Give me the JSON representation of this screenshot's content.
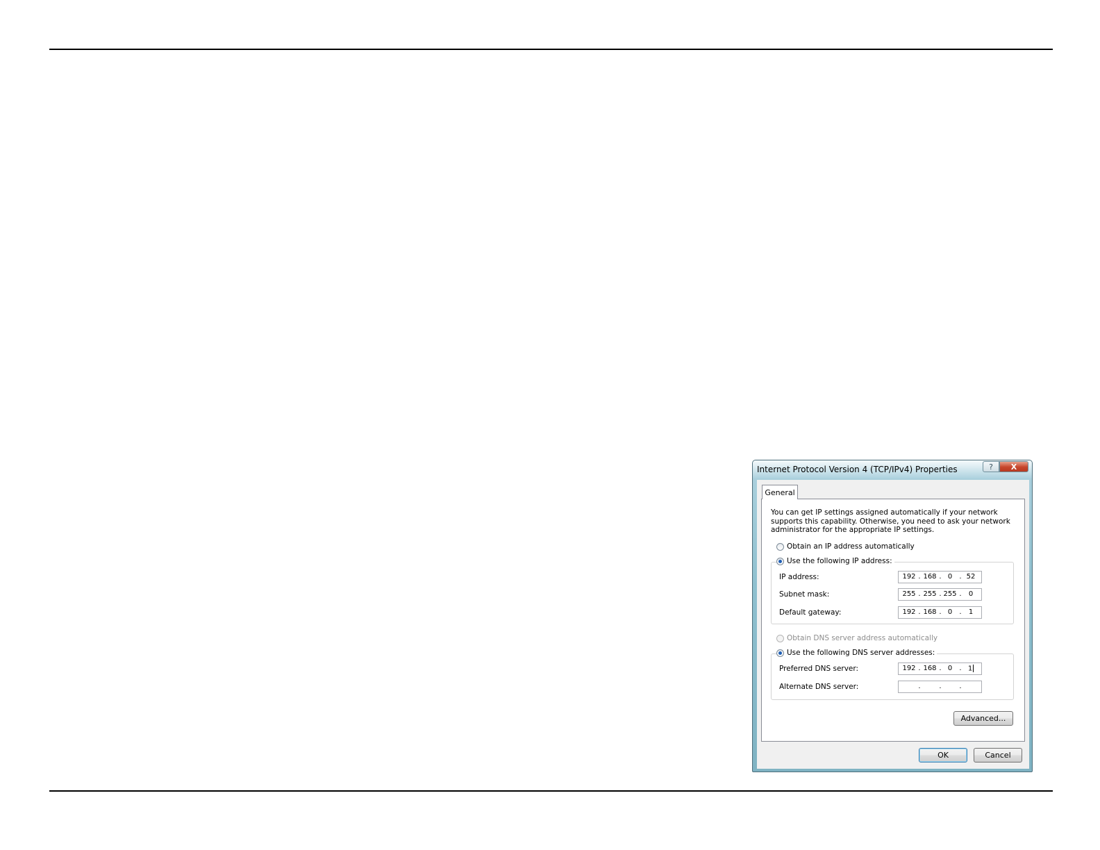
{
  "dialog": {
    "title": "Internet Protocol Version 4 (TCP/IPv4) Properties",
    "help_glyph": "?",
    "close_glyph": "X",
    "tab_label": "General",
    "description": "You can get IP settings assigned automatically if your network supports this capability. Otherwise, you need to ask your network administrator for the appropriate IP settings.",
    "ip_auto_label": "Obtain an IP address automatically",
    "ip_manual_label": "Use the following IP address:",
    "ip_mode": "manual",
    "fields": {
      "ip_address": {
        "label": "IP address:",
        "octets": [
          "192",
          "168",
          "0",
          "52"
        ]
      },
      "subnet_mask": {
        "label": "Subnet mask:",
        "octets": [
          "255",
          "255",
          "255",
          "0"
        ]
      },
      "default_gateway": {
        "label": "Default gateway:",
        "octets": [
          "192",
          "168",
          "0",
          "1"
        ]
      },
      "preferred_dns": {
        "label": "Preferred DNS server:",
        "octets": [
          "192",
          "168",
          "0",
          "1"
        ]
      },
      "alternate_dns": {
        "label": "Alternate DNS server:",
        "octets": [
          "",
          "",
          "",
          ""
        ]
      }
    },
    "dns_auto_label": "Obtain DNS server address automatically",
    "dns_manual_label": "Use the following DNS server addresses:",
    "dns_mode": "manual",
    "dot": ".",
    "advanced_label": "Advanced...",
    "ok_label": "OK",
    "cancel_label": "Cancel"
  }
}
